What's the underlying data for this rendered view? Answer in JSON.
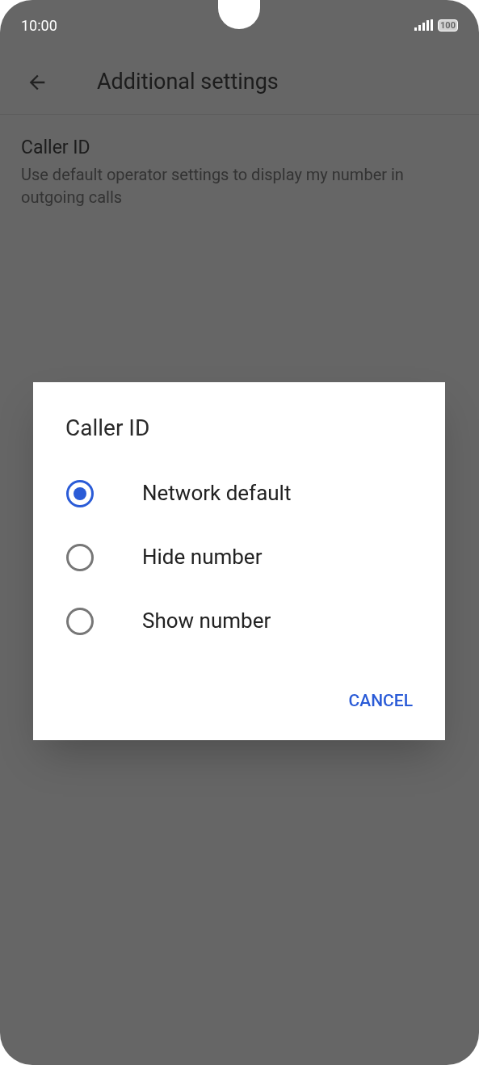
{
  "status_bar": {
    "time": "10:00",
    "battery": "100"
  },
  "app_bar": {
    "title": "Additional settings"
  },
  "settings": [
    {
      "title": "Caller ID",
      "summary": "Use default operator settings to display my number in outgoing calls"
    }
  ],
  "dialog": {
    "title": "Caller ID",
    "options": [
      {
        "label": "Network default",
        "selected": true
      },
      {
        "label": "Hide number",
        "selected": false
      },
      {
        "label": "Show number",
        "selected": false
      }
    ],
    "buttons": [
      "CANCEL"
    ]
  }
}
